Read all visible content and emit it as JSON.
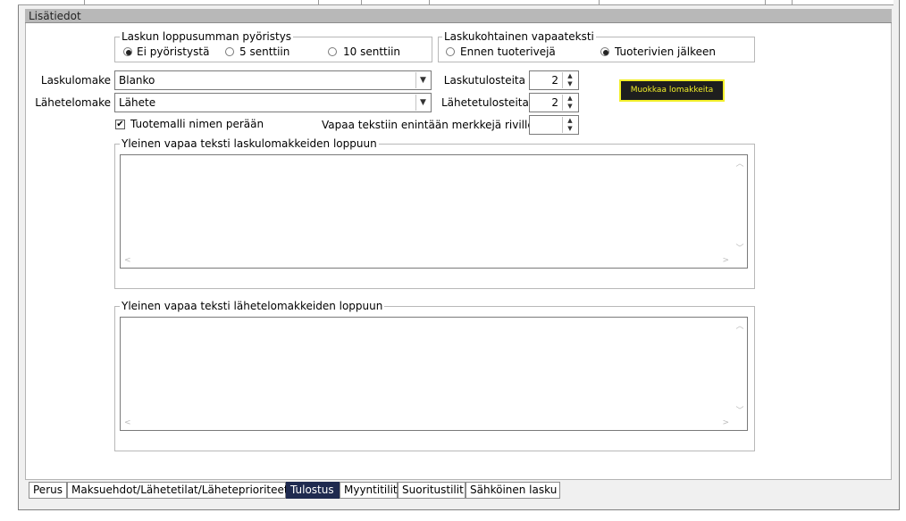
{
  "panel": {
    "title": "Lisätiedot"
  },
  "rounding": {
    "title": "Laskun loppusumman pyöristys",
    "options": [
      {
        "label": "Ei pyöristystä",
        "checked": true
      },
      {
        "label": "5 senttiin",
        "checked": false
      },
      {
        "label": "10 senttiin",
        "checked": false
      }
    ]
  },
  "freetext": {
    "title": "Laskukohtainen vapaateksti",
    "options": [
      {
        "label": "Ennen tuoterivejä",
        "checked": false
      },
      {
        "label": "Tuoterivien jälkeen",
        "checked": true
      }
    ]
  },
  "form": {
    "invoice_form_label": "Laskulomake",
    "invoice_form_value": "Blanko",
    "delivery_form_label": "Lähetelomake",
    "delivery_form_value": "Lähete",
    "invoice_copies_label": "Laskutulosteita",
    "invoice_copies_value": "2",
    "delivery_copies_label": "Lähetetulosteita",
    "delivery_copies_value": "2",
    "product_model_label": "Tuotemalli nimen perään",
    "product_model_checked": true,
    "max_chars_label": "Vapaa tekstiin enintään merkkejä riville",
    "max_chars_value": "",
    "edit_forms_button": "Muokkaa lomakkeita"
  },
  "memo_invoice": {
    "title": "Yleinen vapaa teksti laskulomakkeiden loppuun",
    "value": ""
  },
  "memo_delivery": {
    "title": "Yleinen vapaa teksti lähetelomakkeiden loppuun",
    "value": ""
  },
  "tabs": [
    {
      "label": "Perus",
      "active": false
    },
    {
      "label": "Maksuehdot/Lähetetilat/Läheteprioriteetit",
      "active": false
    },
    {
      "label": "Tulostus",
      "active": true
    },
    {
      "label": "Myyntitilit",
      "active": false
    },
    {
      "label": "Suoritustilit",
      "active": false
    },
    {
      "label": "Sähköinen lasku",
      "active": false
    }
  ],
  "colors": {
    "highlight": "#f2ef2a",
    "active_tab": "#1f2a4f"
  }
}
